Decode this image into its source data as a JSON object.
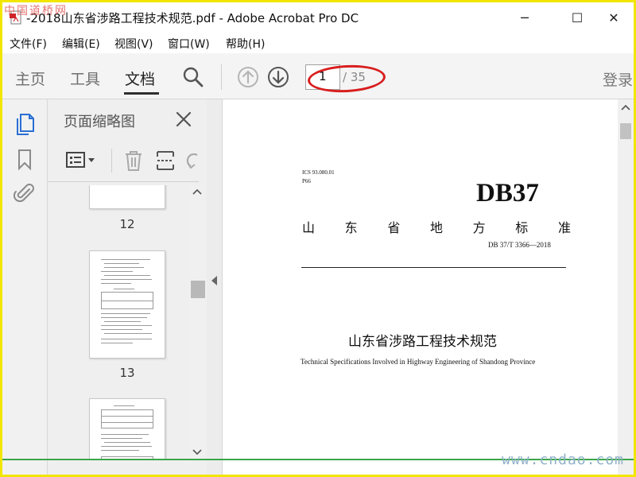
{
  "window": {
    "title": "-2018山东省涉路工程技术规范.pdf - Adobe Acrobat Pro DC",
    "minimize": "─",
    "maximize": "☐",
    "close": "✕"
  },
  "watermark": {
    "top": "中国道桥网",
    "bottom": "www.cndao.com"
  },
  "menu": {
    "file": "文件(F)",
    "edit": "编辑(E)",
    "view": "视图(V)",
    "window": "窗口(W)",
    "help": "帮助(H)"
  },
  "toolbar": {
    "tabs": {
      "home": "主页",
      "tools": "工具",
      "document": "文档"
    },
    "current_page": "1",
    "total_pages": "/ 35",
    "sign_in": "登录"
  },
  "thumbnails": {
    "panel_title": "页面缩略图",
    "pages": [
      {
        "label": "12"
      },
      {
        "label": "13"
      }
    ]
  },
  "document": {
    "ics": "ICS 93.080.01",
    "p_code": "P66",
    "std_code": "DB37",
    "std_name_chars": [
      "山",
      "东",
      "省",
      "地",
      "方",
      "标",
      "准"
    ],
    "std_number": "DB 37/T 3366—2018",
    "title_cn": "山东省涉路工程技术规范",
    "title_en": "Technical Specifications Involved in Highway Engineering of Shandong Province"
  },
  "colors": {
    "frame_border": "#f2e600",
    "annotation_red": "#d81e1e",
    "accent_blue": "#2a6fd4"
  }
}
